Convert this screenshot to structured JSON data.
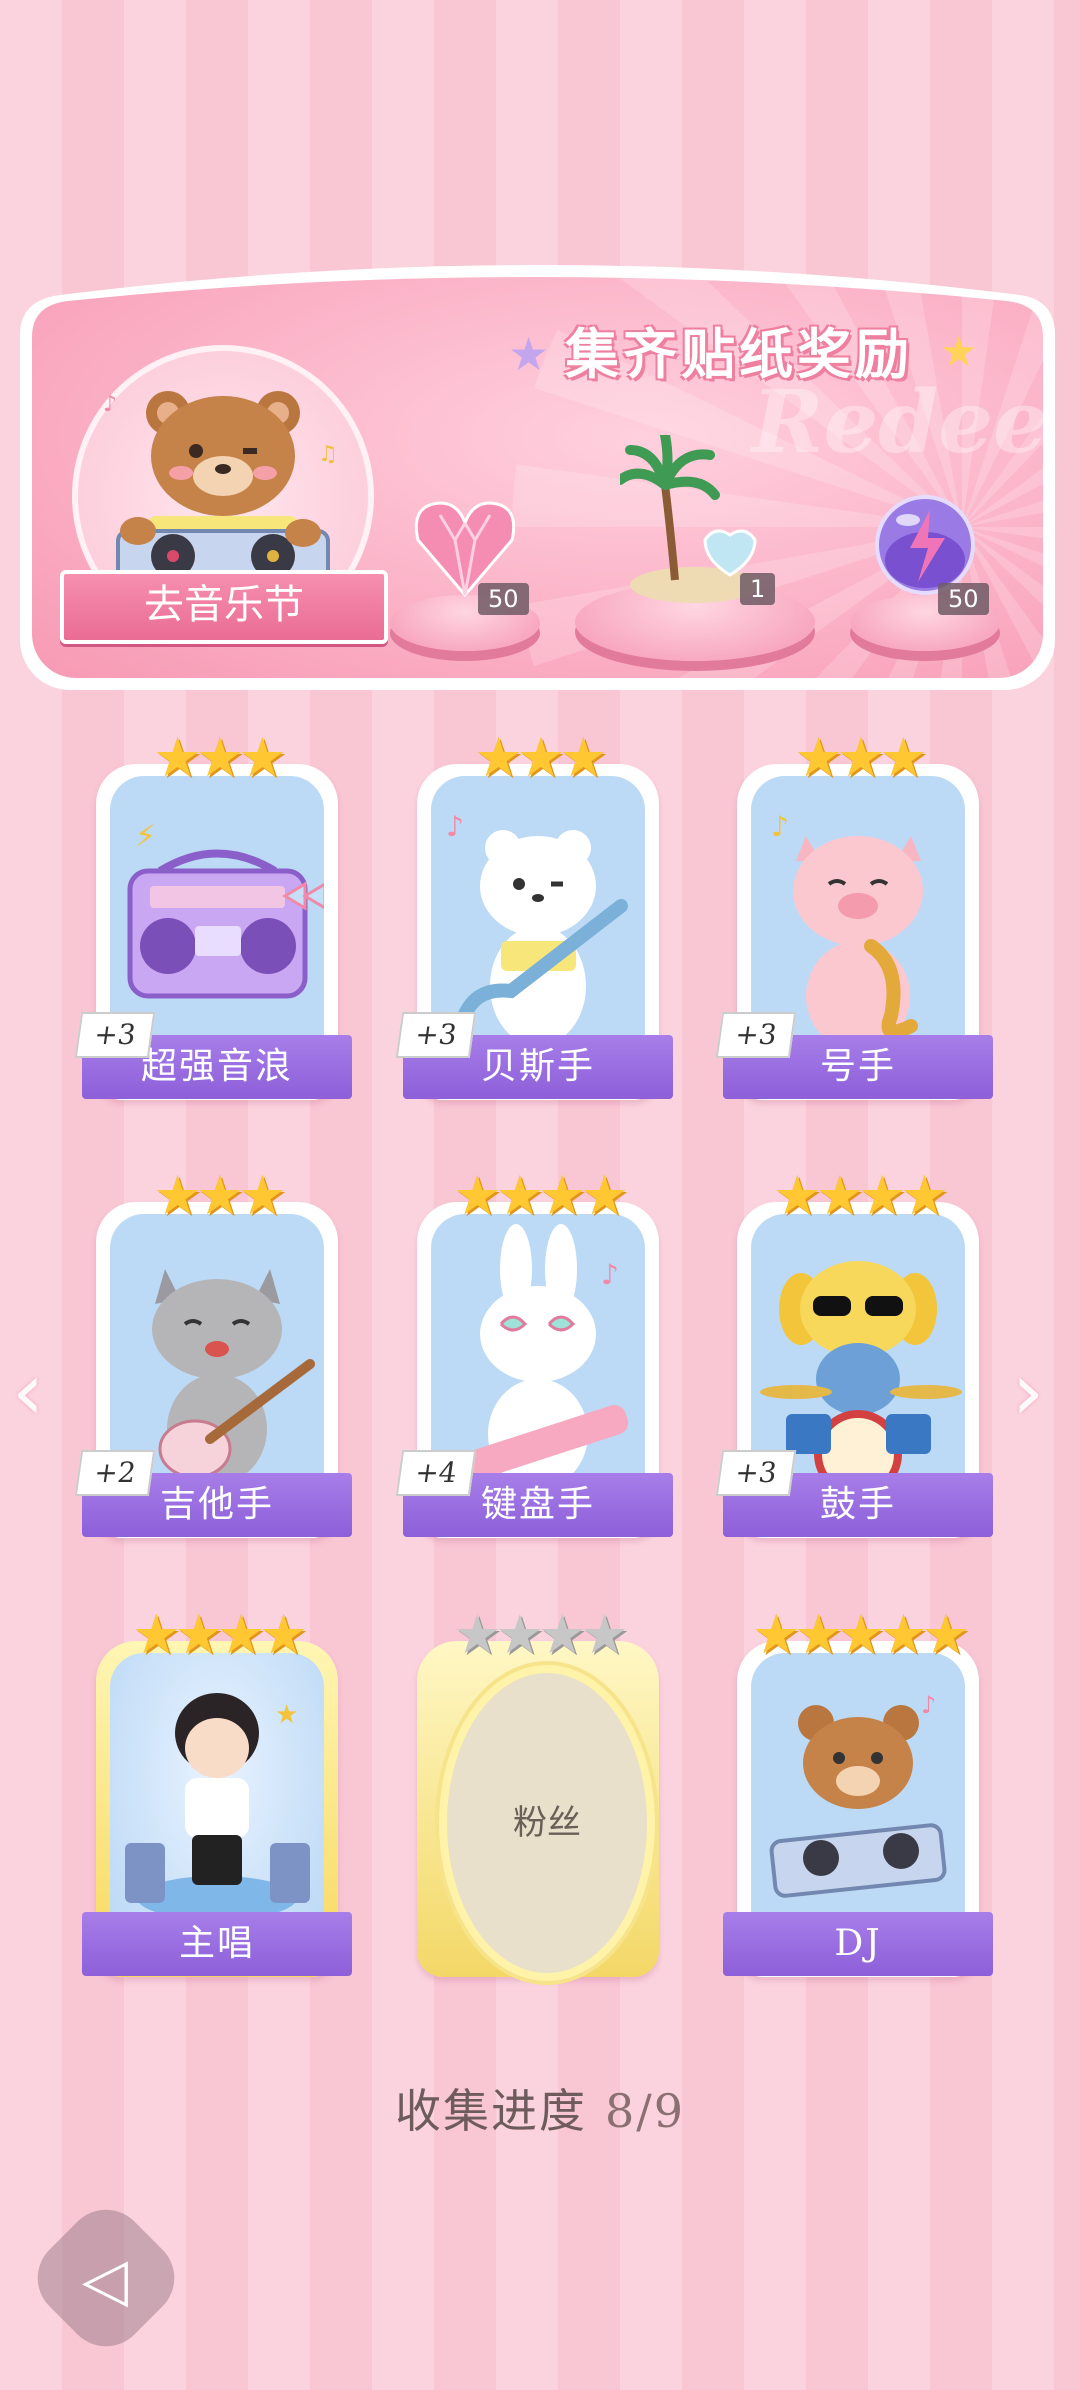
{
  "banner": {
    "title": "集齐贴纸奖励",
    "watermark": "Redeem",
    "festival_button": "去音乐节",
    "rewards": [
      {
        "name": "pink-heart-gem-icon",
        "count": "50"
      },
      {
        "name": "palm-island-icon",
        "count": "1"
      },
      {
        "name": "purple-lightning-orb-icon",
        "count": "50"
      }
    ]
  },
  "stickers": [
    {
      "label": "超强音浪",
      "bonus": "+3",
      "stars": "★★★",
      "collected": true
    },
    {
      "label": "贝斯手",
      "bonus": "+3",
      "stars": "★★★",
      "collected": true
    },
    {
      "label": "号手",
      "bonus": "+3",
      "stars": "★★★",
      "collected": true
    },
    {
      "label": "吉他手",
      "bonus": "+2",
      "stars": "★★★",
      "collected": true
    },
    {
      "label": "键盘手",
      "bonus": "+4",
      "stars": "★★★★",
      "collected": true
    },
    {
      "label": "鼓手",
      "bonus": "+3",
      "stars": "★★★★",
      "collected": true
    },
    {
      "label": "主唱",
      "bonus": "",
      "stars": "★★★★",
      "collected": true
    },
    {
      "label": "粉丝",
      "bonus": "",
      "stars": "★★★★",
      "collected": false
    },
    {
      "label": "DJ",
      "bonus": "",
      "stars": "★★★★★",
      "collected": true
    }
  ],
  "progress": {
    "label": "收集进度",
    "value": "8/9"
  },
  "colors": {
    "label_purple": "#9a6ee0",
    "star_gold": "#ffc833",
    "bg_pink": "#fbd3df"
  }
}
